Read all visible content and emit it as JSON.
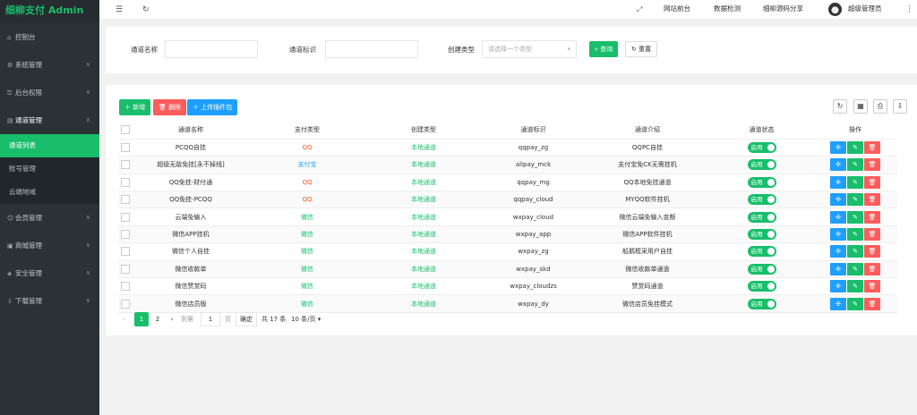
{
  "brand": "细柳支付 Admin",
  "sidebar": {
    "items": [
      {
        "label": "控制台",
        "icon": "home-icon",
        "arrow": ""
      },
      {
        "label": "系统管理",
        "icon": "gear-icon",
        "arrow": "∨"
      },
      {
        "label": "后台权限",
        "icon": "lock-icon",
        "arrow": "∨"
      },
      {
        "label": "通道管理",
        "icon": "channel-icon",
        "arrow": "∧"
      }
    ],
    "sub": [
      "通道列表",
      "账号管理",
      "云端地域"
    ],
    "items_after": [
      {
        "label": "会员管理",
        "icon": "user-icon",
        "arrow": "∨"
      },
      {
        "label": "商城管理",
        "icon": "shop-icon",
        "arrow": "∨"
      },
      {
        "label": "安全管理",
        "icon": "shield-icon",
        "arrow": "∨"
      },
      {
        "label": "下载管理",
        "icon": "download-icon",
        "arrow": "∨"
      }
    ]
  },
  "topbar": {
    "links": [
      "网站前台",
      "数据检测",
      "细柳源码分享"
    ],
    "user": "超级管理员"
  },
  "search": {
    "name_label": "通道名称",
    "id_label": "通道标识",
    "type_label": "创建类型",
    "type_placeholder": "请选择一个类型",
    "search_btn": "查询",
    "reset_btn": "重置"
  },
  "toolbar": {
    "add": "新增",
    "delete": "删除",
    "upload": "上传插件包"
  },
  "table": {
    "headers": [
      "通道名称",
      "支付类型",
      "创建类型",
      "通道标识",
      "通道介绍",
      "通道状态",
      "操作"
    ],
    "rows": [
      {
        "name": "PCQQ自挂",
        "pay": "QQ",
        "pay_color": "#ff5722",
        "mode": "本地通道",
        "id": "qqpay_zg",
        "desc": "QQPC自挂",
        "status": "启用"
      },
      {
        "name": "超级无敌免挂[永不掉线]",
        "pay": "支付宝",
        "pay_color": "#1e9fff",
        "mode": "本地通道",
        "id": "alipay_mck",
        "desc": "支付宝免CK无需挂机",
        "status": "启用"
      },
      {
        "name": "QQ免挂-财付通",
        "pay": "QQ",
        "pay_color": "#ff5722",
        "mode": "本地通道",
        "id": "qqpay_mg",
        "desc": "QQ本地免挂通道",
        "status": "启用"
      },
      {
        "name": "QQ免挂-PCQQ",
        "pay": "QQ",
        "pay_color": "#ff5722",
        "mode": "本地通道",
        "id": "qqpay_cloud",
        "desc": "MYQQ软件挂机",
        "status": "启用"
      },
      {
        "name": "云端免输入",
        "pay": "微信",
        "pay_color": "#19be6b",
        "mode": "本地通道",
        "id": "wxpay_cloud",
        "desc": "微信云端免输入金额",
        "status": "启用"
      },
      {
        "name": "微信APP挂机",
        "pay": "微信",
        "pay_color": "#19be6b",
        "mode": "本地通道",
        "id": "wxpay_app",
        "desc": "微信APP软件挂机",
        "status": "启用"
      },
      {
        "name": "微信个人自挂",
        "pay": "微信",
        "pay_color": "#19be6b",
        "mode": "本地通道",
        "id": "wxpay_zg",
        "desc": "船鹅框采用户自挂",
        "status": "启用"
      },
      {
        "name": "微信收款单",
        "pay": "微信",
        "pay_color": "#19be6b",
        "mode": "本地通道",
        "id": "wxpay_skd",
        "desc": "微信收款单通道",
        "status": "启用"
      },
      {
        "name": "微信赞赏码",
        "pay": "微信",
        "pay_color": "#19be6b",
        "mode": "本地通道",
        "id": "wxpay_cloudzs",
        "desc": "赞赏码通道",
        "status": "启用"
      },
      {
        "name": "微信店员版",
        "pay": "微信",
        "pay_color": "#19be6b",
        "mode": "本地通道",
        "id": "wxpay_dy",
        "desc": "微信店员免挂模式",
        "status": "启用"
      }
    ]
  },
  "pager": {
    "pages": [
      "1",
      "2"
    ],
    "goto_label": "到第",
    "goto_value": "1",
    "page_unit": "页",
    "confirm": "确定",
    "total": "共 17 条",
    "page_size": "10 条/页"
  },
  "colors": {
    "accent": "#19be6b",
    "sidebar": "#2b3135",
    "blue": "#1e9fff",
    "red": "#ff5c5c"
  }
}
